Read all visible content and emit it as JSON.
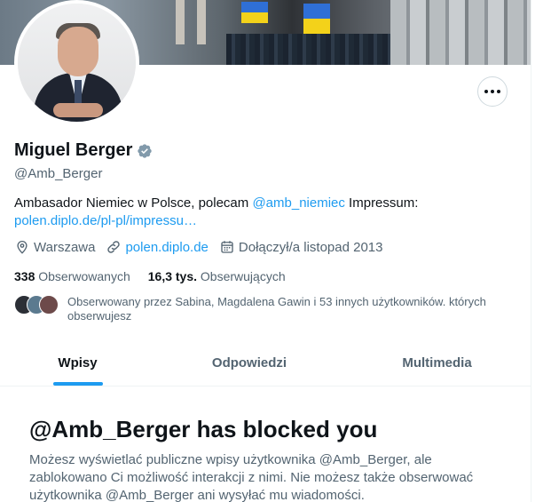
{
  "profile": {
    "name": "Miguel Berger",
    "handle": "@Amb_Berger",
    "bio_prefix": "Ambasador Niemiec w Polsce, polecam ",
    "bio_mention": "@amb_niemiec",
    "bio_suffix": " Impressum:",
    "bio_link": "polen.diplo.de/pl-pl/impressu…",
    "location": "Warszawa",
    "website": "polen.diplo.de",
    "joined": "Dołączył/a listopad 2013",
    "following_count": "338",
    "following_label": "Obserwowanych",
    "followers_count": "16,3 tys.",
    "followers_label": "Obserwujących",
    "followed_by": "Obserwowany przez Sabina, Magdalena Gawin i 53 innych użytkowników. których obserwujesz"
  },
  "tabs": [
    {
      "label": "Wpisy",
      "active": true
    },
    {
      "label": "Odpowiedzi",
      "active": false
    },
    {
      "label": "Multimedia",
      "active": false
    }
  ],
  "blocked": {
    "title": "@Amb_Berger has blocked you",
    "message": "Możesz wyświetlać publiczne wpisy użytkownika @Amb_Berger, ale zablokowano Ci możliwość interakcji z nimi. Nie możesz także obserwować użytkownika @Amb_Berger ani wysyłać mu wiadomości."
  },
  "colors": {
    "accent": "#1d9bf0",
    "text_primary": "#0f1419",
    "text_secondary": "#536471",
    "verified": "#829aab"
  },
  "icons": {
    "more": "more-horizontal-icon",
    "verified": "verified-badge-icon",
    "location": "location-pin-icon",
    "link": "link-icon",
    "calendar": "calendar-icon"
  }
}
